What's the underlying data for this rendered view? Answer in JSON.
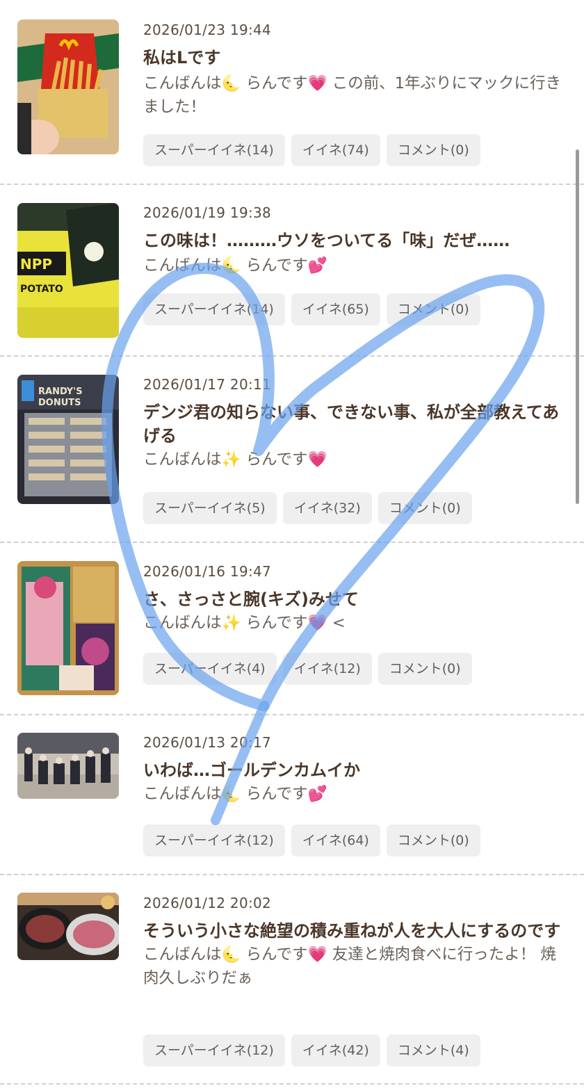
{
  "posts": [
    {
      "date": "2026/01/23 19:44",
      "title": "私はLです",
      "excerpt": "こんばんは🌜 らんです💗 この前、1年ぶりにマックに行きました！",
      "super_like": "スーパーイイネ(14)",
      "like": "イイネ(74)",
      "comment": "コメント(0)"
    },
    {
      "date": "2026/01/19 19:38",
      "title": "この味は！………ウソをついてる「味」だぜ……",
      "excerpt": "こんばんは🌜 らんです💕",
      "super_like": "スーパーイイネ(14)",
      "like": "イイネ(65)",
      "comment": "コメント(0)"
    },
    {
      "date": "2026/01/17 20:11",
      "title": "デンジ君の知らない事、できない事、私が全部教えてあげる",
      "excerpt": "こんばんは✨ らんです💗",
      "super_like": "スーパーイイネ(5)",
      "like": "イイネ(32)",
      "comment": "コメント(0)"
    },
    {
      "date": "2026/01/16 19:47",
      "title": "さ、さっさと腕(キズ)みせて",
      "excerpt": "こんばんは✨ らんです💗 <",
      "super_like": "スーパーイイネ(4)",
      "like": "イイネ(12)",
      "comment": "コメント(0)"
    },
    {
      "date": "2026/01/13 20:17",
      "title": "いわば…ゴールデンカムイか",
      "excerpt": "こんばんは🌜 らんです💕",
      "super_like": "スーパーイイネ(12)",
      "like": "イイネ(64)",
      "comment": "コメント(0)"
    },
    {
      "date": "2026/01/12 20:02",
      "title": "そういう小さな絶望の積み重ねが人を大人にするのです",
      "excerpt": "こんばんは🌜 らんです💗 友達と焼肉食べに行ったよ！ 焼肉久しぶりだぁ",
      "super_like": "スーパーイイネ(12)",
      "like": "イイネ(42)",
      "comment": "コメント(4)"
    }
  ],
  "colors": {
    "title": "#4a3628",
    "date": "#5a4c40",
    "excerpt": "#6b6159",
    "button_bg": "#efefef",
    "separator": "#cfcfcf",
    "heart_stroke": "#6aa3ee"
  }
}
